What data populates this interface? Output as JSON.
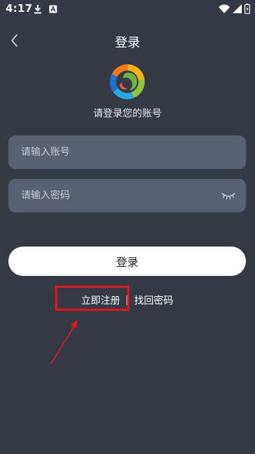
{
  "status_bar": {
    "time": "4:17",
    "icons": [
      "download-icon",
      "app-notification-icon",
      "wifi-icon",
      "signal-icon",
      "battery-icon"
    ]
  },
  "header": {
    "title": "登录",
    "back_icon": "chevron-left-icon"
  },
  "logo": {
    "icon": "app-logo-icon",
    "subtitle": "请登录您的账号"
  },
  "form": {
    "account": {
      "placeholder": "请输入账号",
      "value": ""
    },
    "password": {
      "placeholder": "请输入密码",
      "value": "",
      "toggle_icon": "eye-closed-icon"
    },
    "login_label": "登录"
  },
  "links": {
    "register": "立即注册",
    "forgot": "找回密码"
  },
  "colors": {
    "background": "#353944",
    "input_background": "#5a6073",
    "button_background": "#ffffff",
    "annotation": "#e8141c"
  }
}
